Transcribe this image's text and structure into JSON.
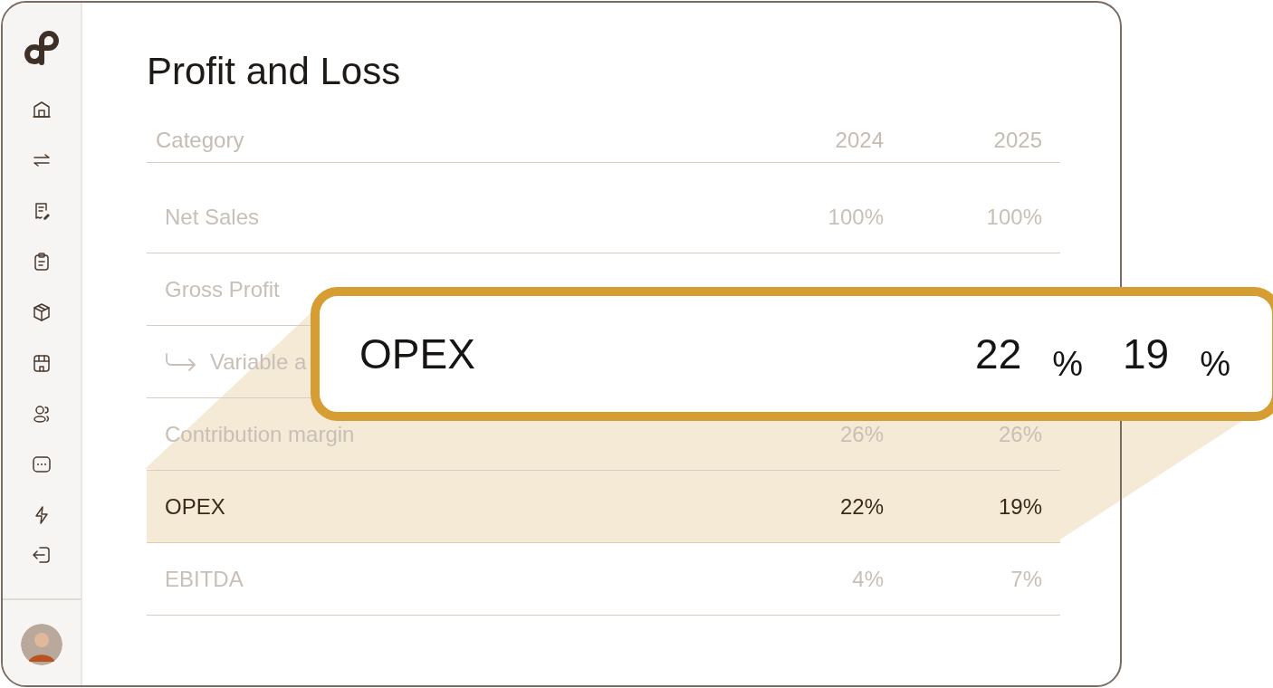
{
  "page": {
    "title": "Profit and Loss"
  },
  "table": {
    "columns": [
      "Category",
      "2024",
      "2025"
    ],
    "rows": [
      {
        "kind": "main",
        "label": "Net Sales",
        "values": [
          "100%",
          "100%"
        ],
        "highlighted": false
      },
      {
        "kind": "main",
        "label": "Gross Profit",
        "values": [],
        "highlighted": false
      },
      {
        "kind": "sub",
        "label": "Variable a",
        "values": [],
        "highlighted": false
      },
      {
        "kind": "main",
        "label": "Contribution margin",
        "values": [
          "26%",
          "26%"
        ],
        "highlighted": false
      },
      {
        "kind": "main",
        "label": "OPEX",
        "values": [
          "22%",
          "19%"
        ],
        "highlighted": true
      },
      {
        "kind": "main",
        "label": "EBITDA",
        "values": [
          "4%",
          "7%"
        ],
        "highlighted": false
      }
    ]
  },
  "callout": {
    "label": "OPEX",
    "values": [
      {
        "number": "22",
        "unit": "%"
      },
      {
        "number": "19",
        "unit": "%"
      }
    ]
  }
}
